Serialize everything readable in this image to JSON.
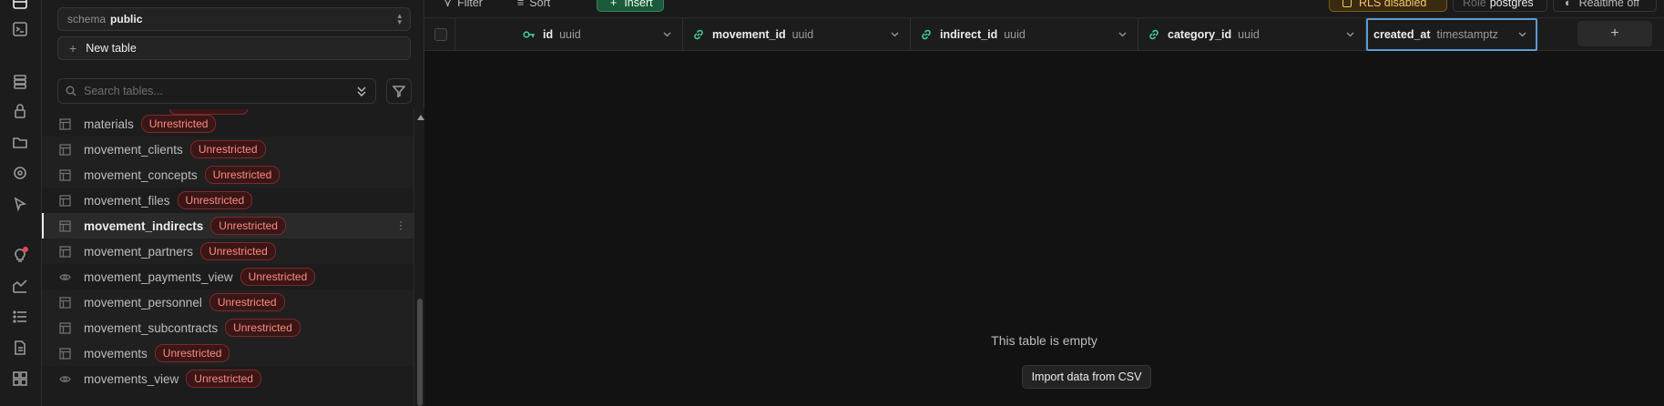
{
  "sidebar": {
    "schema": {
      "label": "schema",
      "value": "public"
    },
    "new_table_label": "New table",
    "search_placeholder": "Search tables...",
    "tables": [
      {
        "name": "materials",
        "badge": "Unrestricted",
        "kind": "table"
      },
      {
        "name": "movement_clients",
        "badge": "Unrestricted",
        "kind": "table"
      },
      {
        "name": "movement_concepts",
        "badge": "Unrestricted",
        "kind": "table"
      },
      {
        "name": "movement_files",
        "badge": "Unrestricted",
        "kind": "table"
      },
      {
        "name": "movement_indirects",
        "badge": "Unrestricted",
        "kind": "table",
        "selected": true
      },
      {
        "name": "movement_partners",
        "badge": "Unrestricted",
        "kind": "table"
      },
      {
        "name": "movement_payments_view",
        "badge": "Unrestricted",
        "kind": "view"
      },
      {
        "name": "movement_personnel",
        "badge": "Unrestricted",
        "kind": "table"
      },
      {
        "name": "movement_subcontracts",
        "badge": "Unrestricted",
        "kind": "table"
      },
      {
        "name": "movements",
        "badge": "Unrestricted",
        "kind": "table"
      },
      {
        "name": "movements_view",
        "badge": "Unrestricted",
        "kind": "view"
      }
    ]
  },
  "toolbar": {
    "filter_label": "Filter",
    "sort_label": "Sort",
    "insert_label": "Insert",
    "rls_label": "RLS disabled",
    "role_label": "Role",
    "role_value": "postgres",
    "realtime_label": "Realtime off"
  },
  "grid": {
    "columns": [
      {
        "name": "id",
        "type": "uuid",
        "icon": "key-icon"
      },
      {
        "name": "movement_id",
        "type": "uuid",
        "icon": "link-icon"
      },
      {
        "name": "indirect_id",
        "type": "uuid",
        "icon": "link-icon"
      },
      {
        "name": "category_id",
        "type": "uuid",
        "icon": "link-icon"
      },
      {
        "name": "created_at",
        "type": "timestamptz",
        "icon": "none",
        "focused": true
      }
    ],
    "add_column_label": "+",
    "empty_message": "This table is empty",
    "import_label": "Import data from CSV"
  },
  "colors": {
    "accent_green": "#3ecf8e",
    "badge_red": "#ff8a80",
    "rls_amber": "#f5c26b",
    "focus_blue": "#5b9bd5"
  }
}
